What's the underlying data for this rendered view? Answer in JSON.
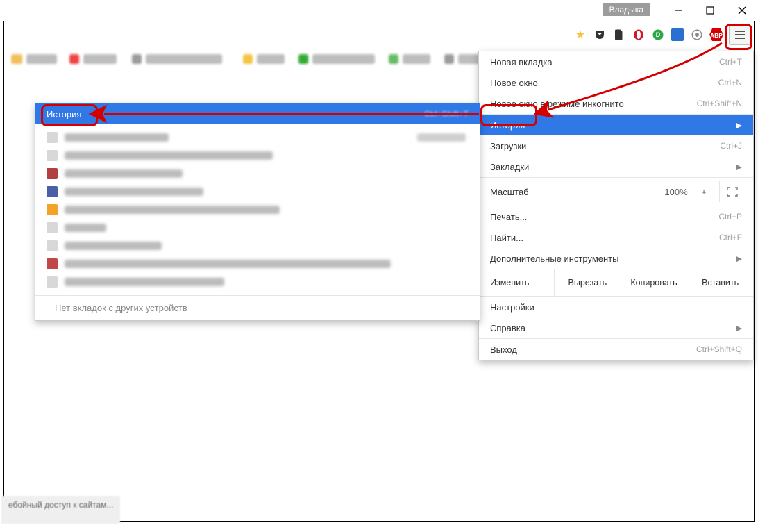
{
  "titlebar": {
    "user": "Владыка"
  },
  "menu": {
    "items": [
      {
        "label": "Новая вкладка",
        "shortcut": "Ctrl+T"
      },
      {
        "label": "Новое окно",
        "shortcut": "Ctrl+N"
      },
      {
        "label": "Новое окно в режиме инкогнито",
        "shortcut": "Ctrl+Shift+N"
      }
    ],
    "history": {
      "label": "История"
    },
    "downloads": {
      "label": "Загрузки",
      "shortcut": "Ctrl+J"
    },
    "bookmarks": {
      "label": "Закладки"
    },
    "zoom": {
      "label": "Масштаб",
      "value": "100%"
    },
    "print": {
      "label": "Печать...",
      "shortcut": "Ctrl+P"
    },
    "find": {
      "label": "Найти...",
      "shortcut": "Ctrl+F"
    },
    "tools": {
      "label": "Дополнительные инструменты"
    },
    "edit": {
      "label": "Изменить",
      "cut": "Вырезать",
      "copy": "Копировать",
      "paste": "Вставить"
    },
    "settings": {
      "label": "Настройки"
    },
    "help": {
      "label": "Справка"
    },
    "exit": {
      "label": "Выход",
      "shortcut": "Ctrl+Shift+Q"
    }
  },
  "history_panel": {
    "title": "История",
    "reopen_shortcut": "Ctrl+Shift+T",
    "footer": "Нет вкладок с других устройств"
  },
  "status": {
    "text": "ебойный доступ к сайтам..."
  }
}
